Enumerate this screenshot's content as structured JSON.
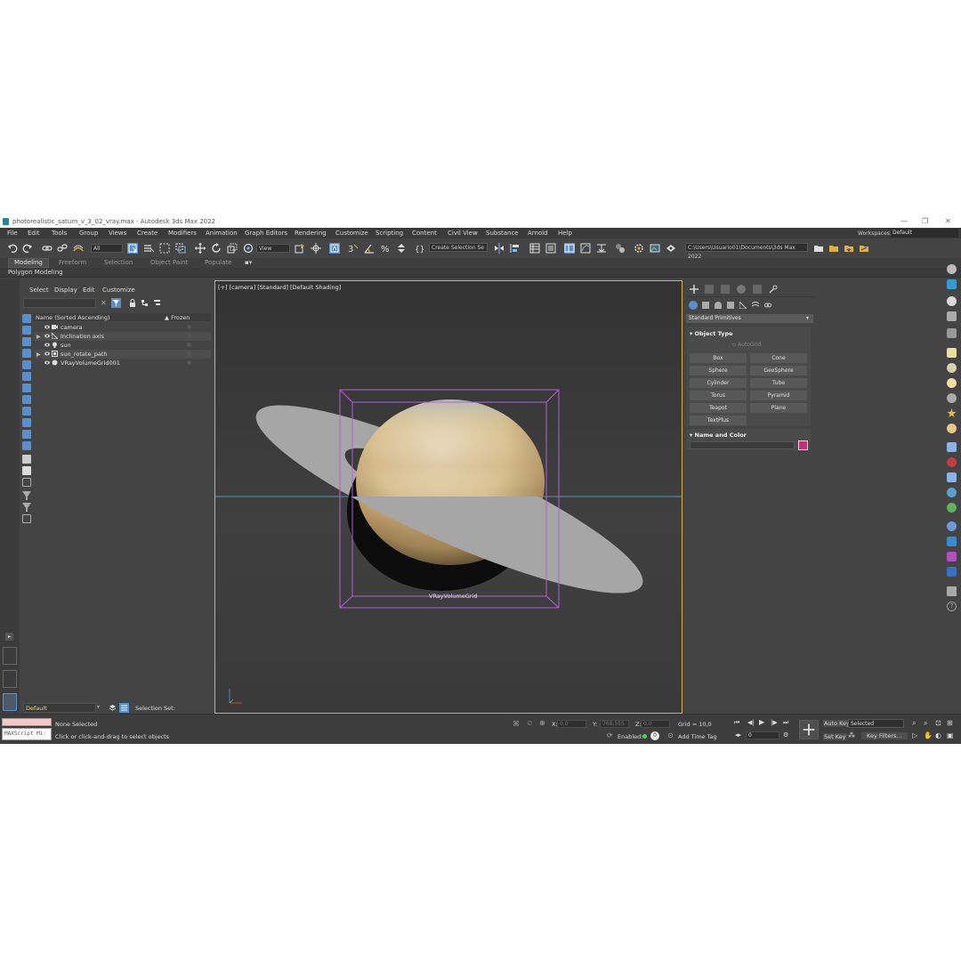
{
  "window": {
    "title": "photorealistic_saturn_v_3_02_vray.max - Autodesk 3ds Max 2022",
    "minimize": "—",
    "maximize": "❐",
    "close": "✕"
  },
  "menu": [
    "File",
    "Edit",
    "Tools",
    "Group",
    "Views",
    "Create",
    "Modifiers",
    "Animation",
    "Graph Editors",
    "Rendering",
    "Customize",
    "Scripting",
    "Content",
    "Civil View",
    "Substance",
    "Arnold",
    "Help"
  ],
  "workspace": {
    "label": "Workspaces:",
    "value": "Default"
  },
  "toolbar": {
    "filter_value": "All",
    "refcoord_value": "View",
    "selection_set_placeholder": "Create Selection Se",
    "project_path": "C:\\Users\\Usuario01\\Documents\\3ds Max 2022"
  },
  "ribbon": {
    "tabs": [
      "Modeling",
      "Freeform",
      "Selection",
      "Object Paint",
      "Populate"
    ],
    "active_tab": "Modeling",
    "sub_label": "Polygon Modeling"
  },
  "explorer": {
    "menu": [
      "Select",
      "Display",
      "Edit",
      "Customize"
    ],
    "column_name": "Name (Sorted Ascending)",
    "column_frozen": "▲ Frozen",
    "rows": [
      {
        "label": "camera",
        "expandable": false
      },
      {
        "label": "Inclination axis",
        "expandable": true
      },
      {
        "label": "sun",
        "expandable": false
      },
      {
        "label": "sun_rotate_path",
        "expandable": true
      },
      {
        "label": "VRayVolumeGrid001",
        "expandable": false
      }
    ],
    "layer_value": "Default",
    "selection_set_label": "Selection Set:"
  },
  "viewport": {
    "label": "[+] [camera] [Standard] [Default Shading]",
    "object_label": "VRayVolumeGrid"
  },
  "command_panel": {
    "category": "Standard Primitives",
    "object_type_title": "Object Type",
    "autogrid_label": "AutoGrid",
    "buttons": [
      "Box",
      "Cone",
      "Sphere",
      "GeoSphere",
      "Cylinder",
      "Tube",
      "Torus",
      "Pyramid",
      "Teapot",
      "Plane",
      "TextPlus"
    ],
    "name_color_title": "Name and Color",
    "object_color": "#c2307a"
  },
  "status": {
    "maxscript_label": "MAXScript Mi:",
    "selection": "None Selected",
    "prompt": "Click or click-and-drag to select objects",
    "x_label": "X:",
    "x_value": "0,0",
    "y_label": "Y:",
    "y_value": "768,555",
    "z_label": "Z:",
    "z_value": "0,0",
    "grid": "Grid = 10,0",
    "enabled_label": "Enabled:",
    "add_time_tag": "Add Time Tag",
    "auto_key": "Auto Key",
    "set_key": "Set Key",
    "key_mode": "Selected",
    "key_filters": "Key Filters...",
    "frame": "0"
  },
  "colors": {
    "accent_blue": "#5a8fc9",
    "viewport_border": "#d8b34a",
    "bbox": "#b65fd8"
  }
}
